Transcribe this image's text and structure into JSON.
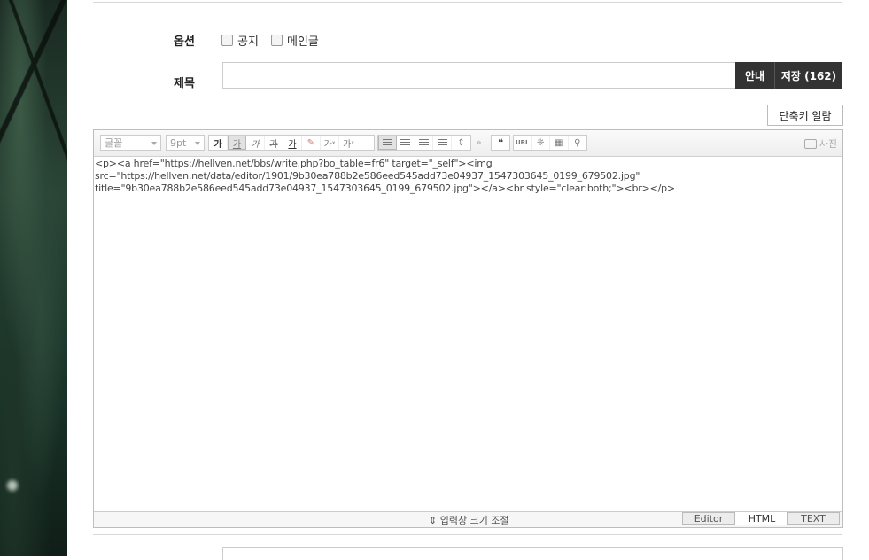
{
  "options": {
    "label": "옵션",
    "checkboxes": [
      {
        "label": "공지",
        "checked": false
      },
      {
        "label": "메인글",
        "checked": false
      }
    ]
  },
  "subject": {
    "label": "제목",
    "value": "",
    "guide_button": "안내",
    "save_button": "저장 (162)"
  },
  "shortcut_button": "단축키 일람",
  "toolbar": {
    "font_select": "글꼴",
    "size_select": "9pt",
    "style_icons": [
      "가",
      "가",
      "가",
      "가",
      "가"
    ],
    "superscript": "가",
    "subscript": "가",
    "quote": "❝",
    "url": "URL",
    "photo_label": "사진"
  },
  "source_text": {
    "line1": "<p><a href=\"https://hellven.net/bbs/write.php?bo_table=fr6\" target=\"_self\"><img",
    "line2": "src=\"https://hellven.net/data/editor/1901/9b30ea788b2e586eed545add73e04937_1547303645_0199_679502.jpg\"",
    "line3": "title=\"9b30ea788b2e586eed545add73e04937_1547303645_0199_679502.jpg\"></a><br style=\"clear:both;\"><br></p>"
  },
  "bottom": {
    "resize_label": "⇕ 입력창 크기 조절",
    "modes": [
      "Editor",
      "HTML",
      "TEXT"
    ],
    "active_mode": "HTML"
  },
  "colors": {
    "button_dark": "#333333",
    "spell_error": "#e03030"
  }
}
